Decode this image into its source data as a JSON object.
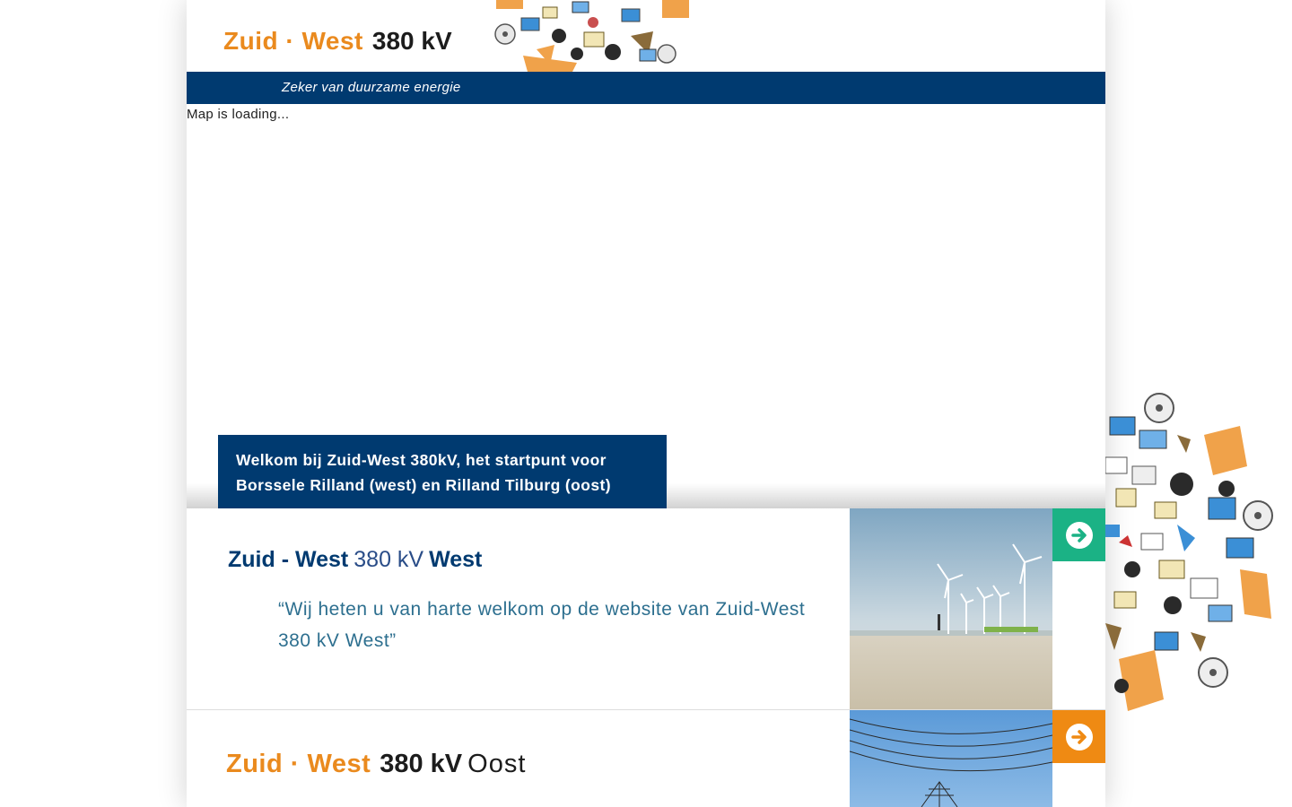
{
  "header": {
    "logo_zuid_west": "Zuid · West",
    "logo_kv": "380 kV",
    "tagline": "Zeker van duurzame energie"
  },
  "map": {
    "loading_text": "Map is loading...",
    "welcome_text": "Welkom bij Zuid-West 380kV, het startpunt voor Borssele Rilland (west) en Rilland Tilburg (oost)"
  },
  "west": {
    "title_bold_1": "Zuid - West",
    "title_light": "380 kV",
    "title_bold_2": "West",
    "quote": "“Wij heten u van harte welkom op de website van Zuid-West 380 kV West”",
    "arrow_color": "#1bb285"
  },
  "oost": {
    "title_zuid_west": "Zuid · West",
    "title_kv": "380 kV",
    "title_oost": "Oost",
    "arrow_color": "#ef8a13"
  },
  "colors": {
    "brand_blue": "#003a70",
    "brand_orange": "#ea8a1e",
    "quote_teal": "#2d6f8f"
  },
  "icons": {
    "arrow": "arrow-right-circle-icon"
  }
}
